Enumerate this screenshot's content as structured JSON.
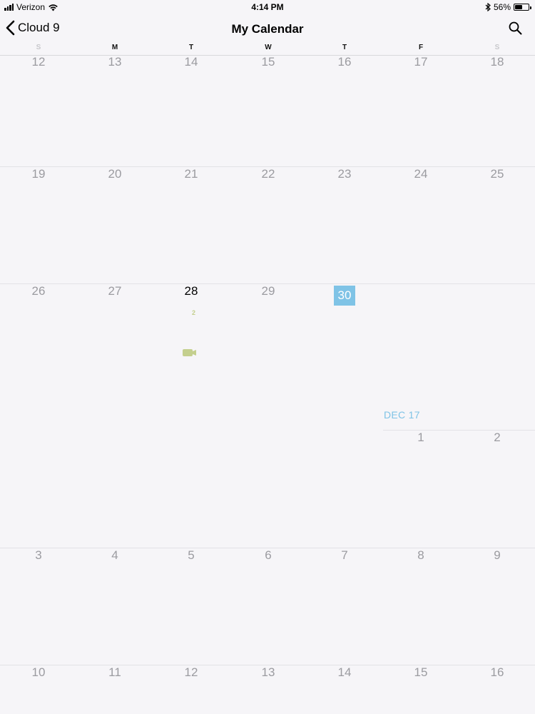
{
  "status_bar": {
    "carrier": "Verizon",
    "time": "4:14 PM",
    "battery_percent": "56%",
    "battery_level": 0.56,
    "icons": [
      "signal-bars-icon",
      "wifi-icon",
      "bluetooth-icon",
      "battery-icon"
    ]
  },
  "nav": {
    "back_label": "Cloud 9",
    "title": "My Calendar",
    "icons": [
      "chevron-left-icon",
      "search-icon"
    ]
  },
  "weekdays": [
    "S",
    "M",
    "T",
    "W",
    "T",
    "F",
    "S"
  ],
  "weeks": [
    [
      "12",
      "13",
      "14",
      "15",
      "16",
      "17",
      "18"
    ],
    [
      "19",
      "20",
      "21",
      "22",
      "23",
      "24",
      "25"
    ],
    [
      "26",
      "27",
      "28",
      "29",
      "30",
      "",
      ""
    ],
    [
      "",
      "",
      "",
      "",
      "",
      "1",
      "2"
    ],
    [
      "3",
      "4",
      "5",
      "6",
      "7",
      "8",
      "9"
    ],
    [
      "10",
      "11",
      "12",
      "13",
      "14",
      "15",
      "16"
    ]
  ],
  "today": "28",
  "selected_day": "30",
  "month_label": "DEC 17",
  "event": {
    "day": "28",
    "count": "2",
    "icon": "video-camera-icon"
  },
  "colors": {
    "accent": "#7fc3e6",
    "event": "#c4cf8e",
    "inactive_text": "#9b9ba0"
  }
}
